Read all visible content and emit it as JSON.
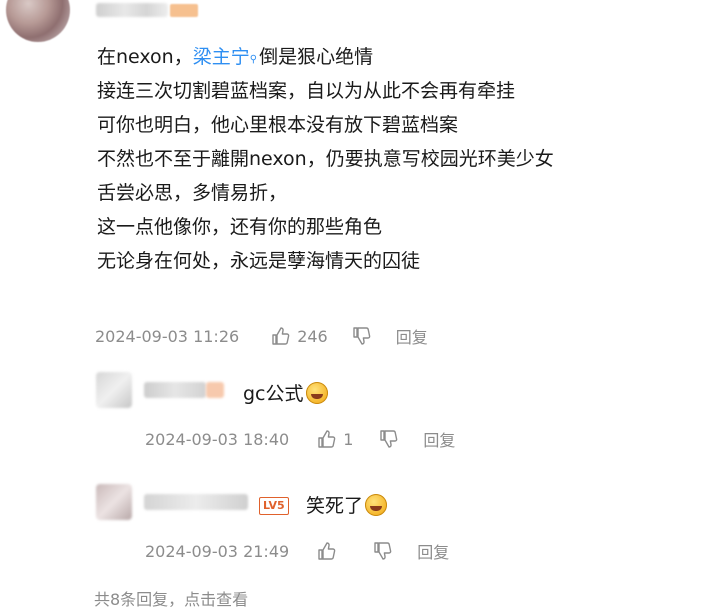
{
  "main_comment": {
    "lines": [
      {
        "before": "在nexon，",
        "mention": "梁主宁",
        "after": "倒是狠心绝情"
      },
      {
        "text": "接连三次切割碧蓝档案，自以为从此不会再有牵挂"
      },
      {
        "text": "可你也明白，他心里根本没有放下碧蓝档案"
      },
      {
        "text": "不然也不至于離開nexon，仍要执意写校园光环美少女"
      },
      {
        "text": "舌尝必思，多情易折，"
      },
      {
        "text": "这一点他像你，还有你的那些角色"
      },
      {
        "text": "无论身在何处，永远是孽海情天的囚徒"
      }
    ],
    "timestamp": "2024-09-03 11:26",
    "like_count": "246",
    "reply_label": "回复"
  },
  "replies": [
    {
      "text": "gc公式",
      "emoji_icon": "laughing-crying-emoji",
      "timestamp": "2024-09-03 18:40",
      "like_count": "1",
      "reply_label": "回复"
    },
    {
      "level_badge": "LV5",
      "text": "笑死了",
      "emoji_icon": "laughing-crying-emoji",
      "timestamp": "2024-09-03 21:49",
      "like_count": "",
      "reply_label": "回复"
    }
  ],
  "more_replies_text": "共8条回复，点击查看",
  "colors": {
    "text": "#1a1a1a",
    "meta": "#8c8c8c",
    "mention": "#2f8ff2",
    "level_badge": "#e0612c"
  }
}
